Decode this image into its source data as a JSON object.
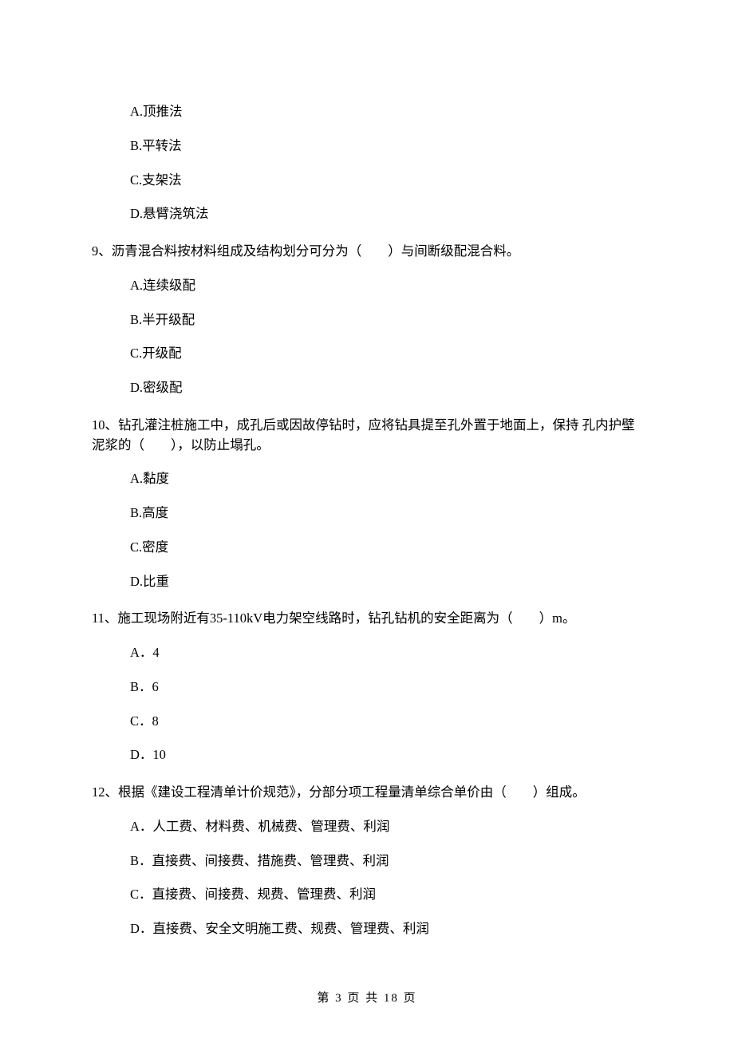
{
  "q8_options": {
    "a": "A.顶推法",
    "b": "B.平转法",
    "c": "C.支架法",
    "d": "D.悬臂浇筑法"
  },
  "q9": {
    "stem": "9、沥青混合料按材料组成及结构划分可分为（　　）与间断级配混合料。",
    "a": "A.连续级配",
    "b": "B.半开级配",
    "c": "C.开级配",
    "d": "D.密级配"
  },
  "q10": {
    "stem": "10、钻孔灌注桩施工中，成孔后或因故停钻时，应将钻具提至孔外置于地面上，保持 孔内护壁泥浆的（　　），以防止塌孔。",
    "a": "A.黏度",
    "b": "B.高度",
    "c": "C.密度",
    "d": "D.比重"
  },
  "q11": {
    "stem": "11、施工现场附近有35-110kV电力架空线路时，钻孔钻机的安全距离为（　　）m。",
    "a": "A．4",
    "b": "B．6",
    "c": "C．8",
    "d": "D．10"
  },
  "q12": {
    "stem": "12、根据《建设工程清单计价规范》，分部分项工程量清单综合单价由（　　）组成。",
    "a": "A．人工费、材料费、机械费、管理费、利润",
    "b": "B．直接费、间接费、措施费、管理费、利润",
    "c": "C．直接费、间接费、规费、管理费、利润",
    "d": "D．直接费、安全文明施工费、规费、管理费、利润"
  },
  "footer": "第 3 页 共 18 页"
}
